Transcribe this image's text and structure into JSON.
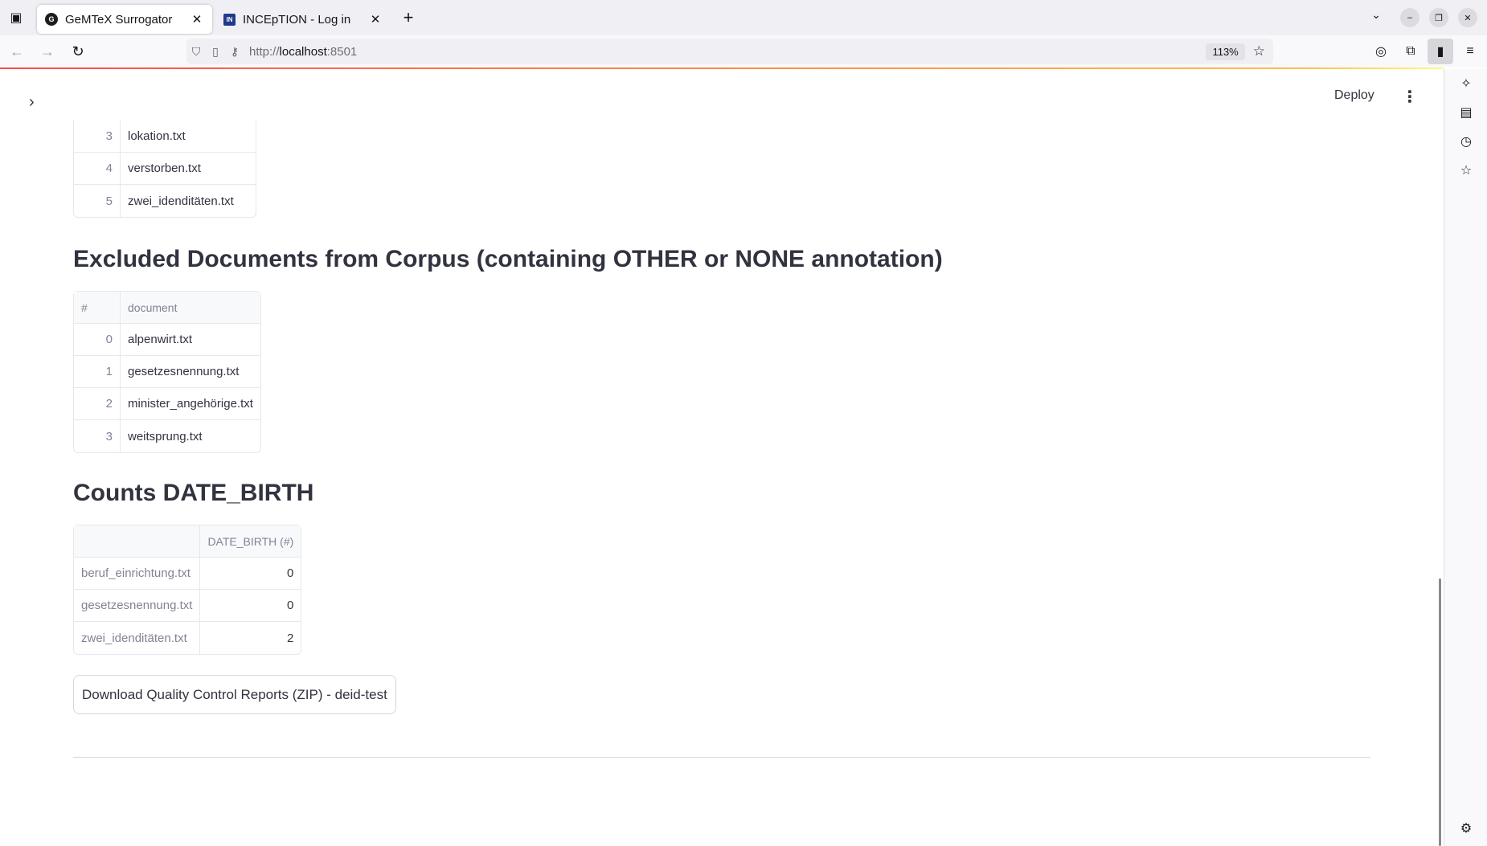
{
  "browser": {
    "tabs": [
      {
        "title": "GeMTeX Surrogator",
        "favicon": "G"
      },
      {
        "title": "INCEpTION - Log in",
        "favicon": "IN"
      }
    ],
    "url_scheme": "http://",
    "url_host": "localhost",
    "url_port": ":8501",
    "zoom": "113%"
  },
  "app": {
    "deploy_label": "Deploy",
    "top_table": {
      "rows": [
        {
          "index": "3",
          "document": "lokation.txt"
        },
        {
          "index": "4",
          "document": "verstorben.txt"
        },
        {
          "index": "5",
          "document": "zwei_idenditäten.txt"
        }
      ]
    },
    "excluded_section": {
      "heading": "Excluded Documents from Corpus (containing OTHER or NONE annotation)",
      "columns": [
        "#",
        "document"
      ],
      "rows": [
        {
          "index": "0",
          "document": "alpenwirt.txt"
        },
        {
          "index": "1",
          "document": "gesetzesnennung.txt"
        },
        {
          "index": "2",
          "document": "minister_angehörige.txt"
        },
        {
          "index": "3",
          "document": "weitsprung.txt"
        }
      ]
    },
    "counts_section": {
      "heading": "Counts DATE_BIRTH",
      "columns": [
        "",
        "DATE_BIRTH (#)"
      ],
      "rows": [
        {
          "name": "beruf_einrichtung.txt",
          "value": "0"
        },
        {
          "name": "gesetzesnennung.txt",
          "value": "0"
        },
        {
          "name": "zwei_idenditäten.txt",
          "value": "2"
        }
      ]
    },
    "download_button": "Download Quality Control Reports (ZIP) - deid-test"
  }
}
